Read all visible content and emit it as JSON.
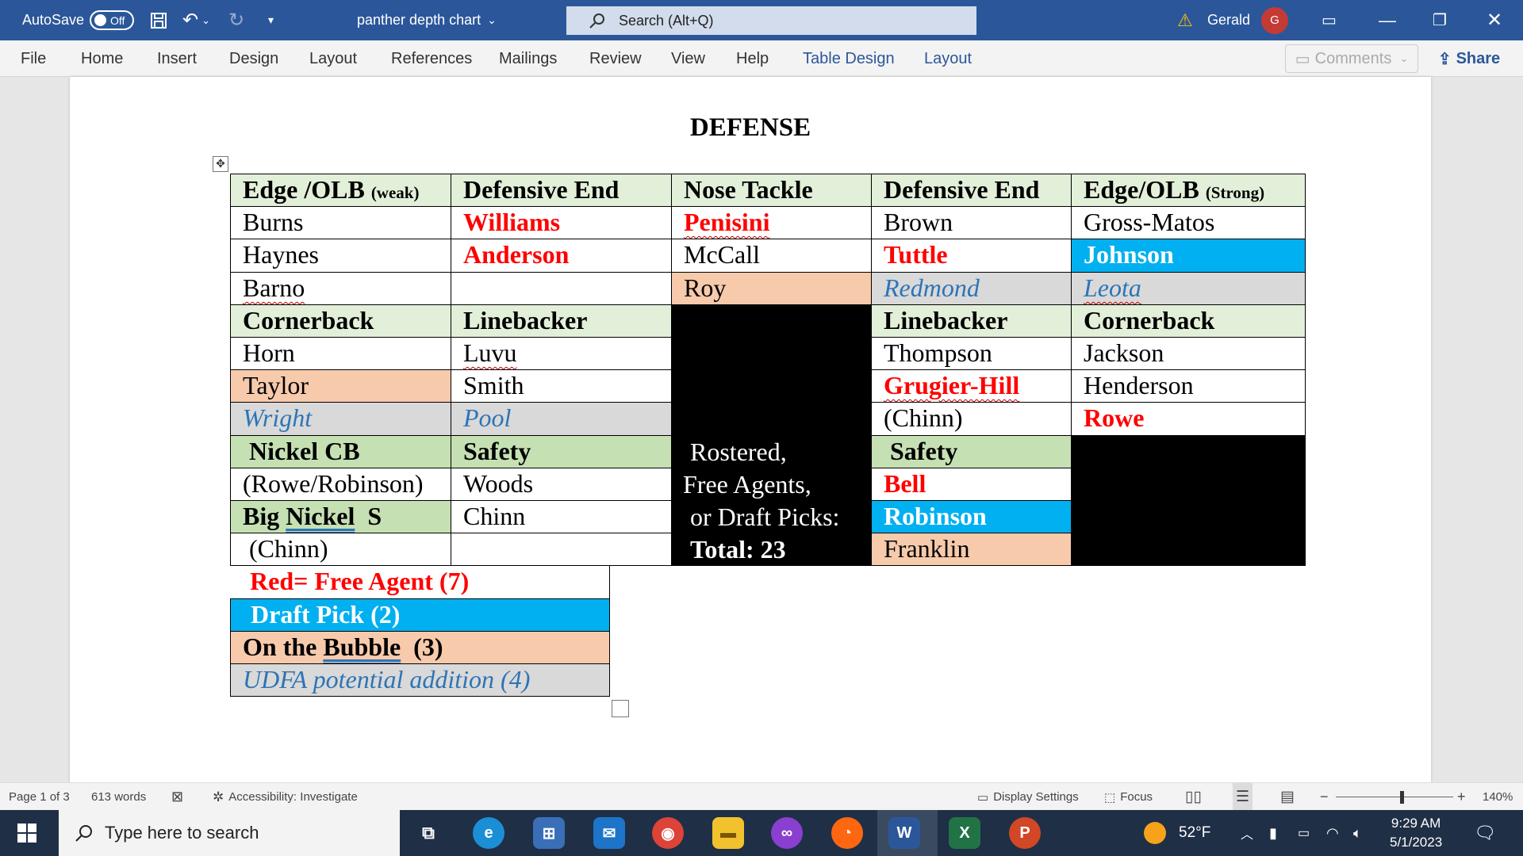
{
  "titlebar": {
    "autosave": "AutoSave",
    "toggle": "Off",
    "doc_title": "panther depth chart",
    "search": "Search (Alt+Q)",
    "user": "Gerald",
    "avatar_initial": "G"
  },
  "ribbon": {
    "tabs": [
      "File",
      "Home",
      "Insert",
      "Design",
      "Layout",
      "References",
      "Mailings",
      "Review",
      "View",
      "Help",
      "Table Design",
      "Layout"
    ],
    "comments": "Comments",
    "share": "Share"
  },
  "document": {
    "title": "DEFENSE",
    "headers": {
      "edge_weak": "Edge /OLB",
      "edge_weak_note": "(weak)",
      "de1": "Defensive End",
      "nt": "Nose Tackle",
      "de2": "Defensive End",
      "edge_strong": "Edge/OLB",
      "edge_strong_note": "(Strong)"
    },
    "row1": [
      "Burns",
      "Williams",
      "Penisini",
      "Brown",
      "Gross-Matos"
    ],
    "row2": [
      "Haynes",
      "Anderson",
      "McCall",
      "Tuttle",
      "Johnson"
    ],
    "row3": [
      "Barno",
      "",
      "Roy",
      "Redmond",
      "Leota"
    ],
    "headers2": {
      "cb1": "Cornerback",
      "lb1": "Linebacker",
      "lb2": "Linebacker",
      "cb2": "Cornerback"
    },
    "row4": [
      "Horn",
      "Luvu",
      "Thompson",
      "Jackson"
    ],
    "row5": [
      "Taylor",
      "Smith",
      "Grugier-Hill",
      "Henderson"
    ],
    "row6": [
      "Wright",
      "Pool",
      "(Chinn)",
      "Rowe"
    ],
    "headers3": {
      "nickel": "Nickel CB",
      "safety1": "Safety",
      "safety2": "Safety"
    },
    "summary": {
      "line1": "Rostered,",
      "line2": "Free Agents,",
      "line3": "or Draft Picks:",
      "total": "Total: 23"
    },
    "row7": [
      "(Rowe/Robinson)",
      "Woods",
      "Bell"
    ],
    "big_nickel_a": "Big ",
    "big_nickel_b": "Nickel",
    "big_nickel_c": "  S",
    "row8": [
      "Chinn",
      "Robinson"
    ],
    "row9": [
      "(Chinn)",
      "",
      "Franklin"
    ],
    "legend": {
      "fa": "Red= Free Agent (7)",
      "dp": "Draft Pick (2)",
      "bubble_a": "On the ",
      "bubble_b": "Bubble",
      "bubble_c": "  (3)",
      "udfa": "UDFA potential addition (4)"
    }
  },
  "statusbar": {
    "page": "Page 1 of 3",
    "words": "613 words",
    "accessibility": "Accessibility: Investigate",
    "display": "Display Settings",
    "focus": "Focus",
    "zoom": "140%",
    "zoom_level": 0.56
  },
  "taskbar": {
    "search": "Type here to search",
    "weather": "52°F",
    "time": "9:29 AM",
    "date": "5/1/2023",
    "word": "W",
    "excel": "X",
    "ppt": "P"
  },
  "colors": {
    "title_bar": "#2b579a",
    "header_green": "#e2efd9",
    "header_green_dark": "#c5e0b3",
    "free_agent": "#ff0000",
    "draft_pick": "#00b0f0",
    "bubble": "#f7caac",
    "udfa_bg": "#d9d9d9",
    "udfa_text": "#2e74b5"
  }
}
